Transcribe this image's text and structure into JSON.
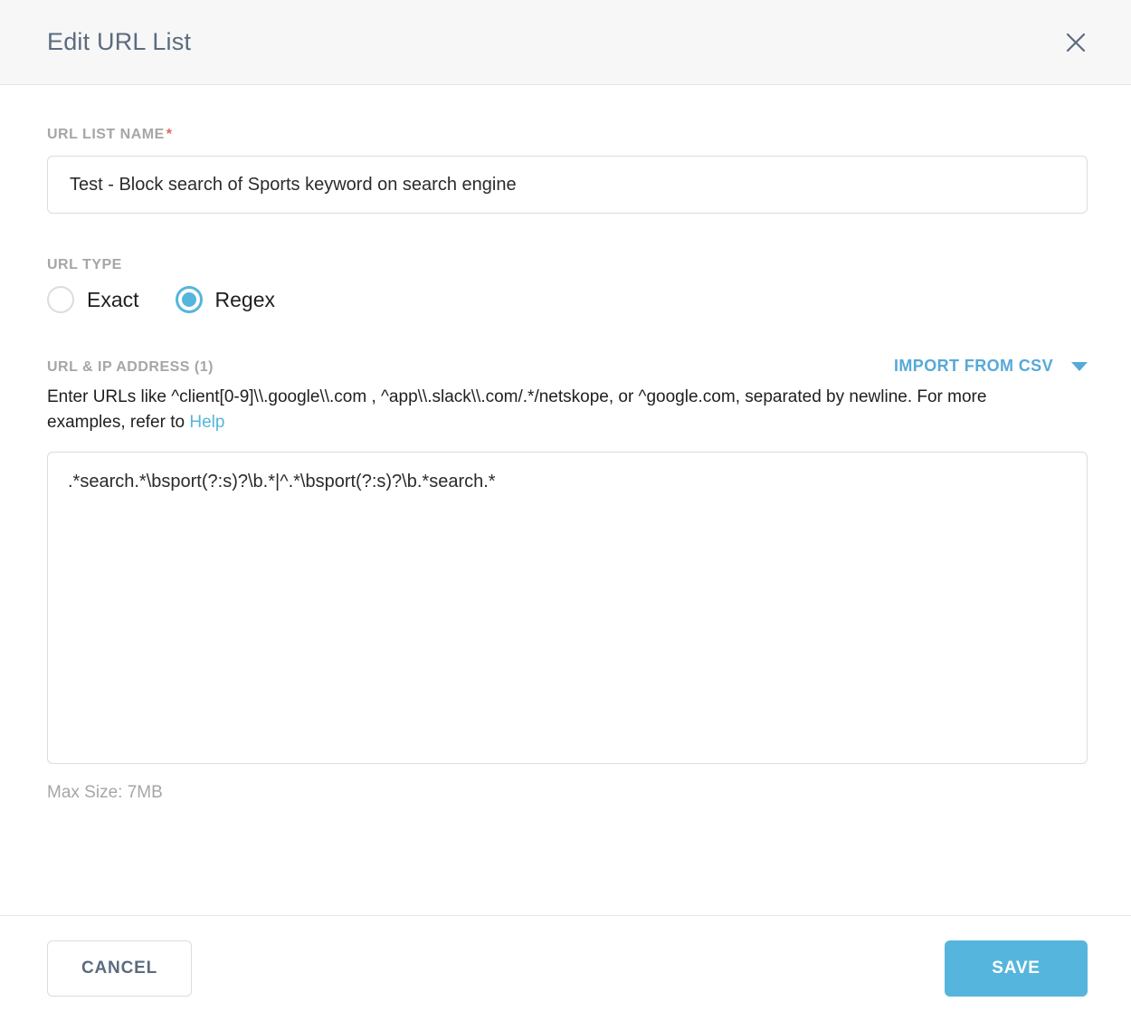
{
  "header": {
    "title": "Edit URL List",
    "close_icon": "close-icon"
  },
  "form": {
    "name_label": "URL LIST NAME",
    "required_marker": "*",
    "name_value": "Test - Block search of Sports keyword on search engine",
    "name_placeholder": "URL List Name",
    "url_type_label": "URL TYPE",
    "url_type_options": [
      {
        "label": "Exact",
        "selected": false
      },
      {
        "label": "Regex",
        "selected": true
      }
    ],
    "list_label": "URL & IP ADDRESS (1)",
    "import_label": "IMPORT FROM CSV",
    "import_caret_icon": "chevron-down-icon",
    "helper_text_before": "Enter URLs like ^client[0-9]\\\\.google\\\\.com , ^app\\\\.slack\\\\.com/.*/netskope, or ^google.com, separated by newline. For more examples, refer to ",
    "helper_link": "Help",
    "urls_value": ".*search.*\\bsport(?:s)?\\b.*|^.*\\bsport(?:s)?\\b.*search.*",
    "urls_placeholder": "",
    "max_size": "Max Size: 7MB"
  },
  "footer": {
    "cancel_label": "CANCEL",
    "save_label": "SAVE"
  },
  "colors": {
    "accent": "#56b5dd",
    "link": "#56a9d8",
    "title": "#5b6b7f",
    "label": "#a6a6a6",
    "required": "#e8635a",
    "border": "#dcdcdc",
    "header_bg": "#f7f7f7"
  }
}
